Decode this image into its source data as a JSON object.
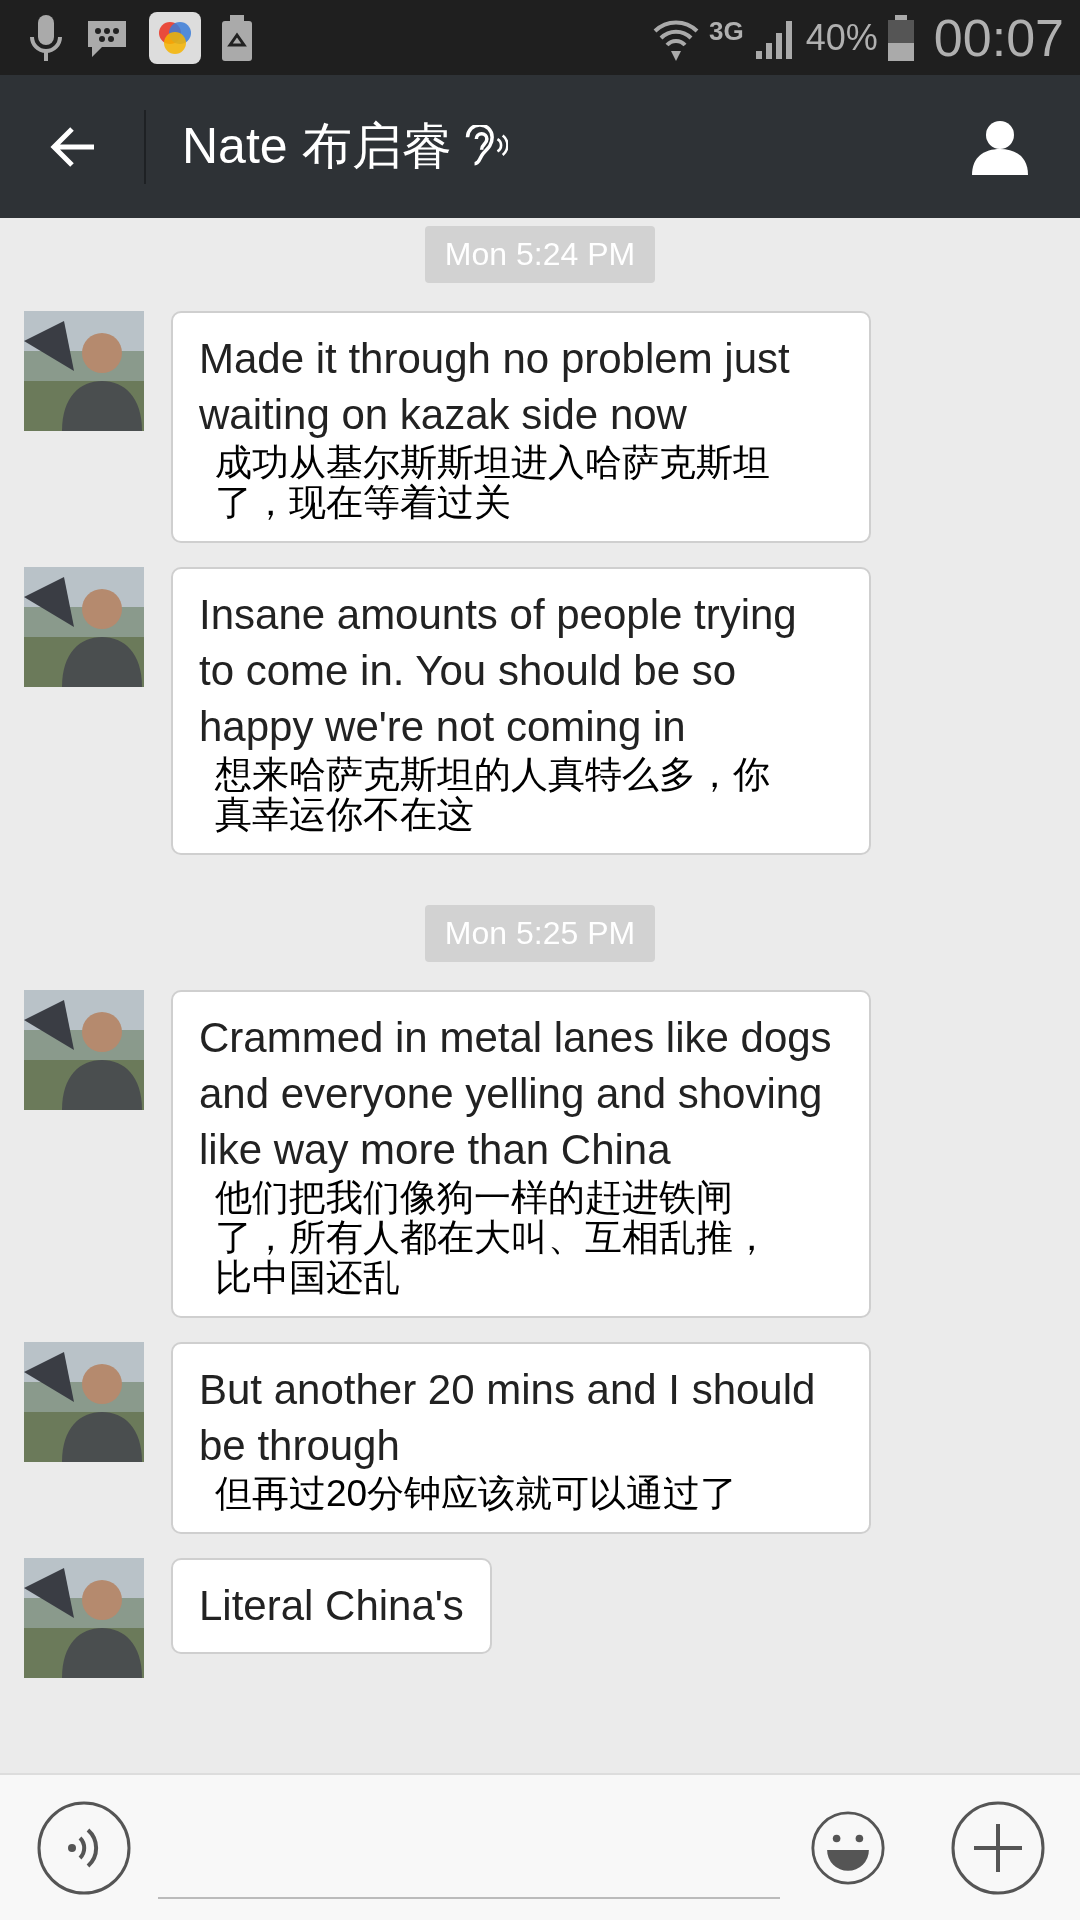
{
  "status_bar": {
    "network": "3G",
    "battery": "40%",
    "time": "00:07"
  },
  "header": {
    "title": "Nate 布启睿"
  },
  "messages": [
    {
      "kind": "time",
      "text": "Mon 5:24 PM"
    },
    {
      "kind": "bubble",
      "text": "Made it through no problem just waiting on kazak side now",
      "translation": "成功从基尔斯斯坦进入哈萨克斯坦了，现在等着过关"
    },
    {
      "kind": "bubble",
      "text": "Insane amounts of people trying to come in. You should be so happy we're not coming in",
      "translation": "想来哈萨克斯坦的人真特么多，你真幸运你不在这"
    },
    {
      "kind": "time",
      "text": "Mon 5:25 PM"
    },
    {
      "kind": "bubble",
      "text": "Crammed in metal lanes like dogs and everyone yelling and shoving like way more than China",
      "translation": "他们把我们像狗一样的赶进铁闸了，所有人都在大叫、互相乱推，比中国还乱"
    },
    {
      "kind": "bubble",
      "text": "But another 20 mins and I should be through",
      "translation": "但再过20分钟应该就可以通过了"
    },
    {
      "kind": "bubble",
      "text": "Literal China's"
    }
  ]
}
